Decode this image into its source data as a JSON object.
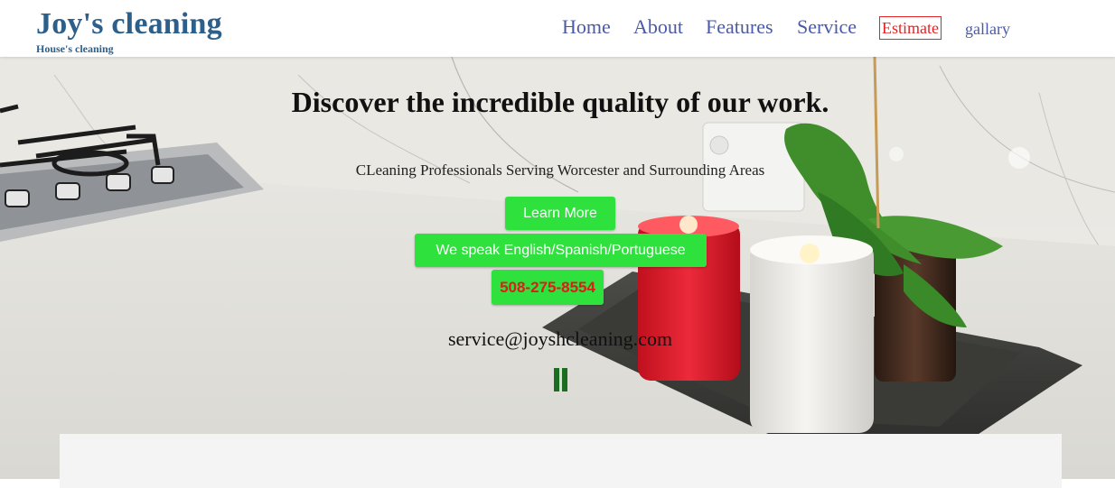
{
  "brand": {
    "title": "Joy's cleaning",
    "subtitle": "House's cleaning"
  },
  "nav": {
    "items": [
      {
        "label": "Home"
      },
      {
        "label": "About"
      },
      {
        "label": "Features"
      },
      {
        "label": "Service"
      },
      {
        "label": "Estimate",
        "style": "boxed-red"
      },
      {
        "label": "gallary"
      }
    ]
  },
  "hero": {
    "heading": "Discover the incredible quality of our work.",
    "subheading": "CLeaning Professionals Serving Worcester and Surrounding Areas",
    "learn_more": "Learn More",
    "languages": "We speak English/Spanish/Portuguese",
    "phone": "508-275-8554",
    "email": "service@joyshcleaning.com",
    "pause_icon": "pause-icon"
  },
  "colors": {
    "brand": "#2c5f8a",
    "nav": "#4a5aa8",
    "estimate": "#e02424",
    "button_green": "#2ee13d",
    "phone_text": "#e11a1a"
  }
}
